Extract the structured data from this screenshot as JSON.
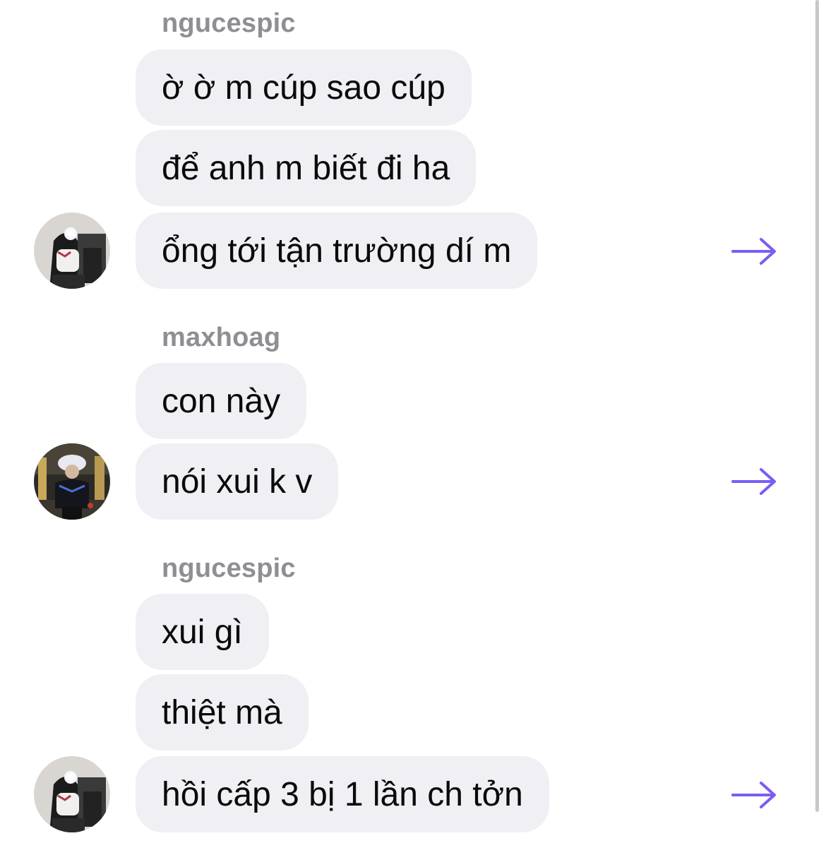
{
  "groups": [
    {
      "sender": "ngucespic",
      "avatar": "avatar-ngucespic",
      "messages": [
        "ờ ờ m cúp sao cúp",
        "để anh m biết đi ha",
        "ổng tới tận trường dí m"
      ]
    },
    {
      "sender": "maxhoag",
      "avatar": "avatar-maxhoag",
      "messages": [
        "con này",
        "nói xui k v"
      ]
    },
    {
      "sender": "ngucespic",
      "avatar": "avatar-ngucespic",
      "messages": [
        "xui gì",
        "thiệt mà",
        "hồi cấp 3 bị 1 lần ch tởn"
      ]
    }
  ],
  "icons": {
    "share": "arrow-right-icon"
  },
  "colors": {
    "bubble": "#efeff4",
    "sender_name": "#8e8e93",
    "accent": "#7b5cf5"
  }
}
